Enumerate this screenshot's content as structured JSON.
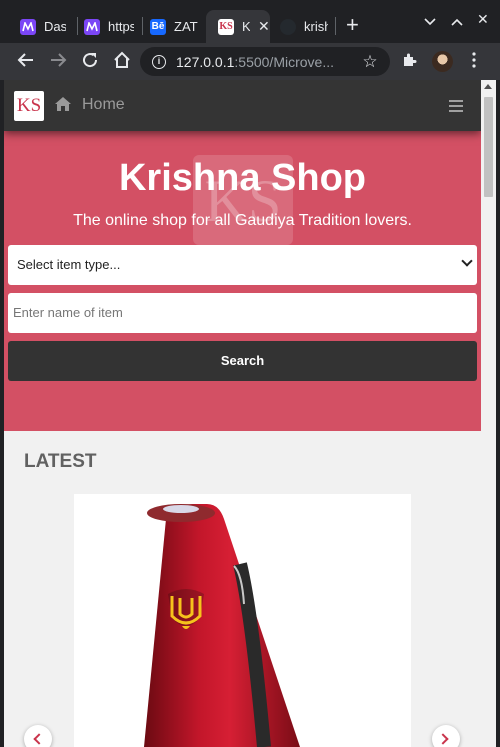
{
  "browser": {
    "tabs": [
      {
        "title": "Dash",
        "favicon": "make-logo-icon",
        "color": "#7b46f6"
      },
      {
        "title": "https",
        "favicon": "make-logo-icon",
        "color": "#7b46f6"
      },
      {
        "title": "ZATT",
        "favicon": "behance-icon",
        "favicon_text": "Bē",
        "color": "#1769ff"
      },
      {
        "title": "K",
        "favicon": "ks-logo-icon",
        "favicon_text": "KS",
        "color": "#c9344c"
      },
      {
        "title": "krish",
        "favicon": "github-icon",
        "color": "#24292e"
      }
    ],
    "url_host": "127.0.0.1",
    "url_rest": ":5500/Microve..."
  },
  "navbar": {
    "logo": "KS",
    "home_label": "Home"
  },
  "hero": {
    "title": "Krishna Shop",
    "subtitle": "The online shop for all Gaudiya Tradition lovers.",
    "watermark": "KS",
    "select_value": "Select item type...",
    "input_placeholder": "Enter name of item",
    "search_label": "Search"
  },
  "latest": {
    "heading": "LATEST"
  },
  "colors": {
    "hero_bg": "#d35064",
    "navbar_bg": "#343434",
    "accent": "#c9344c"
  }
}
